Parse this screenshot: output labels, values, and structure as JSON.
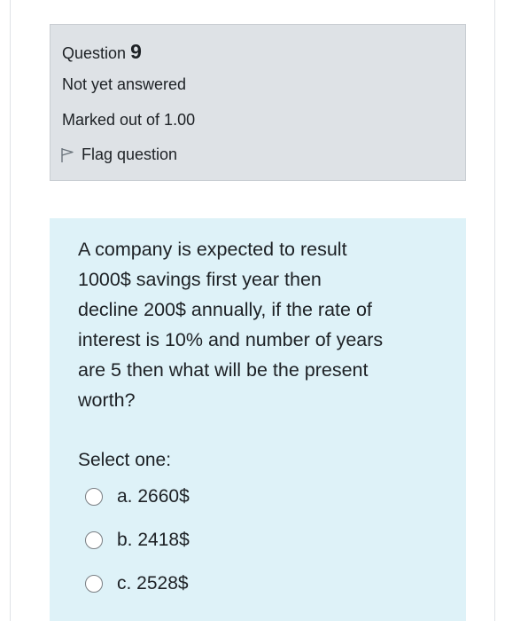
{
  "question_info": {
    "label": "Question",
    "number": "9",
    "state": "Not yet answered",
    "grade": "Marked out of 1.00",
    "flag_label": "Flag question"
  },
  "question": {
    "text_lines": [
      "A company is expected to result",
      "1000$ savings first year then",
      "decline 200$ annually, if the rate of",
      "interest is 10% and number of years",
      "are 5 then what will be the present",
      "worth?"
    ],
    "prompt": "Select one:",
    "options": [
      {
        "label": "a. 2660$"
      },
      {
        "label": "b. 2418$"
      },
      {
        "label": "c. 2528$"
      }
    ]
  },
  "colors": {
    "info_background": "#dee2e6",
    "content_background": "#def2f8"
  }
}
